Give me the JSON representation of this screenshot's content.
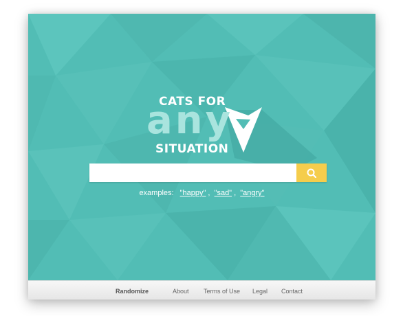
{
  "logo": {
    "line1": "CATS FOR",
    "line2": "any",
    "line3": "SITUATION",
    "icon": "cat-head-icon"
  },
  "search": {
    "value": "",
    "placeholder": "",
    "button_icon": "search-icon",
    "button_color": "#f5cd4c"
  },
  "examples": {
    "label": "examples:",
    "items": [
      "\"happy\"",
      "\"sad\"",
      "\"angry\""
    ],
    "separator": ","
  },
  "footer": {
    "links": [
      "Randomize",
      "About",
      "Terms of Use",
      "Legal",
      "Contact"
    ]
  },
  "colors": {
    "background": "#52bdb5",
    "accent": "#f5cd4c",
    "logo_any": "#a9e4de"
  }
}
